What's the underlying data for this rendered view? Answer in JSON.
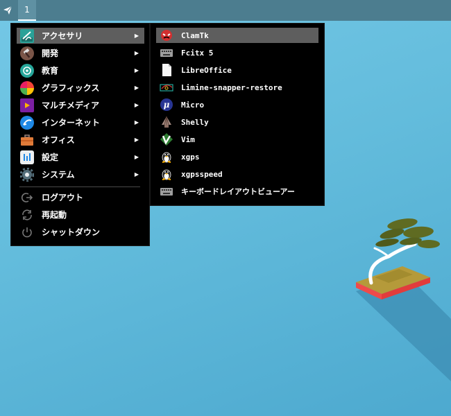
{
  "taskbar": {
    "launcher_icon": "paper-plane-icon",
    "workspace_label": "1"
  },
  "main_menu": {
    "items": [
      {
        "label": "アクセサリ",
        "icon": "accessories-icon",
        "has_submenu": true,
        "highlighted": true
      },
      {
        "label": "開発",
        "icon": "hammer-icon",
        "has_submenu": true
      },
      {
        "label": "教育",
        "icon": "education-icon",
        "has_submenu": true
      },
      {
        "label": "グラフィックス",
        "icon": "graphics-icon",
        "has_submenu": true
      },
      {
        "label": "マルチメディア",
        "icon": "multimedia-icon",
        "has_submenu": true
      },
      {
        "label": "インターネット",
        "icon": "internet-icon",
        "has_submenu": true
      },
      {
        "label": "オフィス",
        "icon": "briefcase-icon",
        "has_submenu": true
      },
      {
        "label": "設定",
        "icon": "settings-icon",
        "has_submenu": true
      },
      {
        "label": "システム",
        "icon": "gear-icon",
        "has_submenu": true
      }
    ],
    "session": [
      {
        "label": "ログアウト",
        "icon": "logout-icon"
      },
      {
        "label": "再起動",
        "icon": "restart-icon"
      },
      {
        "label": "シャットダウン",
        "icon": "power-icon"
      }
    ],
    "arrow_glyph": "▶"
  },
  "submenu": {
    "items": [
      {
        "label": "ClamTk",
        "icon": "clamtk-icon",
        "highlighted": true
      },
      {
        "label": "Fcitx 5",
        "icon": "keyboard-icon"
      },
      {
        "label": "LibreOffice",
        "icon": "document-icon"
      },
      {
        "label": "Limine-snapper-restore",
        "icon": "limine-icon"
      },
      {
        "label": "Micro",
        "icon": "micro-icon"
      },
      {
        "label": "Shelly",
        "icon": "shelly-icon"
      },
      {
        "label": "Vim",
        "icon": "vim-icon"
      },
      {
        "label": "xgps",
        "icon": "tux-icon"
      },
      {
        "label": "xgpsspeed",
        "icon": "tux-icon"
      },
      {
        "label": "キーボードレイアウトビューアー",
        "icon": "keyboard-icon"
      }
    ]
  },
  "colors": {
    "menu_bg": "#000000",
    "highlight": "#5e5e5e",
    "taskbar": "#4c7d8f",
    "desktop": "#63bcdc"
  }
}
